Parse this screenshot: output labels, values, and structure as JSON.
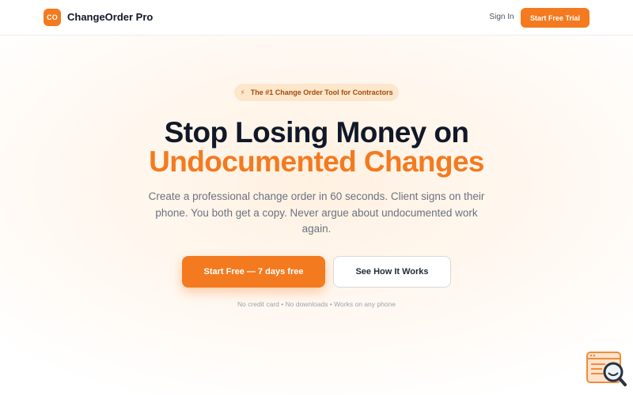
{
  "header": {
    "logo_initials": "CO",
    "brand_name": "ChangeOrder Pro",
    "sign_in_label": "Sign In",
    "trial_button_label": "Start Free Trial"
  },
  "hero": {
    "badge_icon": "lightning-icon",
    "badge_text": "The #1 Change Order Tool for Contractors",
    "headline_line1": "Stop Losing Money on",
    "headline_line2": "Undocumented Changes",
    "subtext": "Create a professional change order in 60 seconds. Client signs on their phone. You both get a copy. Never argue about undocumented work again.",
    "primary_cta_label": "Start Free — 7 days free",
    "secondary_cta_label": "See How It Works",
    "footnote": "No credit card • No downloads • Works on any phone"
  },
  "widget": {
    "icon": "search-document-icon"
  },
  "colors": {
    "accent": "#f47a1f",
    "heading": "#111827",
    "muted_text": "#6b7280",
    "badge_bg": "#fde7cc"
  }
}
